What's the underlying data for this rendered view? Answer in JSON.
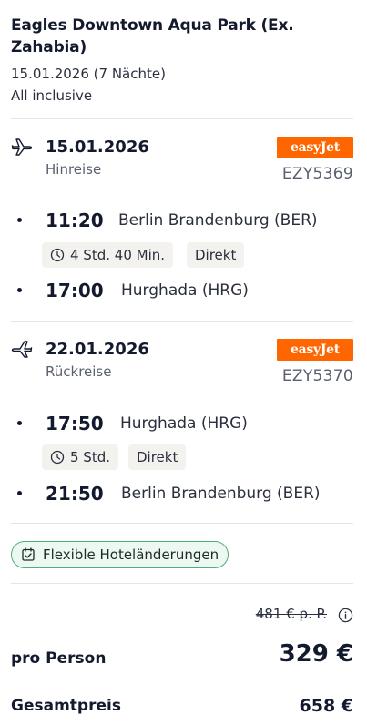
{
  "hotel": {
    "name": "Eagles Downtown Aqua Park (Ex. Zahabia)",
    "dates": "15.01.2026 (7 Nächte)",
    "board": "All inclusive"
  },
  "outbound": {
    "date": "15.01.2026",
    "direction": "Hinreise",
    "airline": "easyJet",
    "flight_number": "EZY5369",
    "departure_time": "11:20",
    "departure_place": "Berlin Brandenburg (BER)",
    "duration": "4 Std. 40 Min.",
    "stops": "Direkt",
    "arrival_time": "17:00",
    "arrival_place": "Hurghada (HRG)"
  },
  "return": {
    "date": "22.01.2026",
    "direction": "Rückreise",
    "airline": "easyJet",
    "flight_number": "EZY5370",
    "departure_time": "17:50",
    "departure_place": "Hurghada (HRG)",
    "duration": "5 Std.",
    "stops": "Direkt",
    "arrival_time": "21:50",
    "arrival_place": "Berlin Brandenburg (BER)"
  },
  "feature": {
    "label": "Flexible Hoteländerungen"
  },
  "pricing": {
    "old_price": "481 € p. P.",
    "per_person_label": "pro Person",
    "per_person_price": "329 €",
    "total_label": "Gesamtpreis",
    "total_price": "658 €"
  },
  "colors": {
    "brand_airline": "#ff6600",
    "feature_border": "#4fae7f",
    "chip_bg": "#f3f2ee"
  },
  "icons": {
    "outbound": "plane-departure-icon",
    "return": "plane-arrival-icon",
    "duration": "clock-icon",
    "feature": "checklist-icon",
    "info": "info-icon"
  }
}
